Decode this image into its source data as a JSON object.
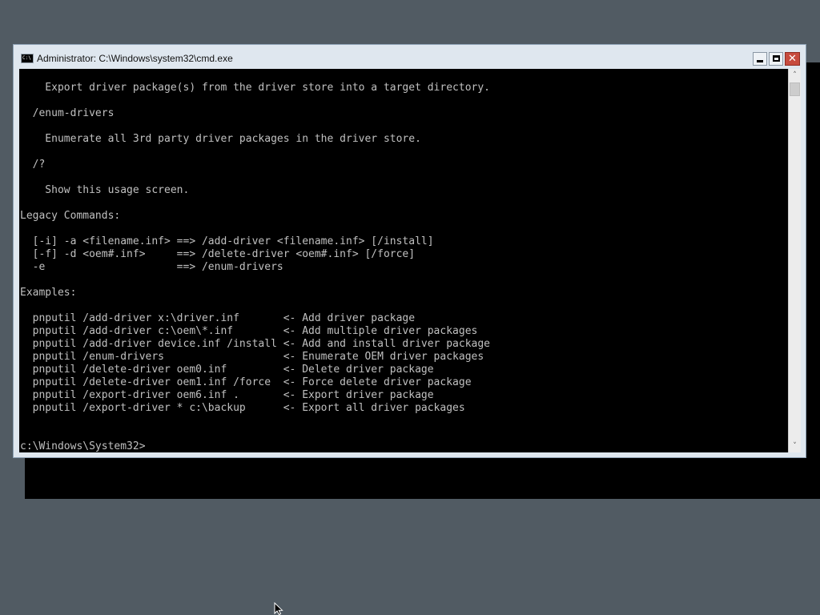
{
  "window": {
    "title": "Administrator: C:\\Windows\\system32\\cmd.exe",
    "icon_text": "C:\\",
    "icon": "cmd-icon",
    "controls": {
      "minimize": "minimize-icon",
      "maximize": "maximize-icon",
      "close_glyph": "✕"
    }
  },
  "console": {
    "lines": [
      "    Export driver package(s) from the driver store into a target directory.",
      "",
      "  /enum-drivers",
      "",
      "    Enumerate all 3rd party driver packages in the driver store.",
      "",
      "  /?",
      "",
      "    Show this usage screen.",
      "",
      "Legacy Commands:",
      "",
      "  [-i] -a <filename.inf> ==> /add-driver <filename.inf> [/install]",
      "  [-f] -d <oem#.inf>     ==> /delete-driver <oem#.inf> [/force]",
      "  -e                     ==> /enum-drivers",
      "",
      "Examples:",
      "",
      "  pnputil /add-driver x:\\driver.inf       <- Add driver package",
      "  pnputil /add-driver c:\\oem\\*.inf        <- Add multiple driver packages",
      "  pnputil /add-driver device.inf /install <- Add and install driver package",
      "  pnputil /enum-drivers                   <- Enumerate OEM driver packages",
      "  pnputil /delete-driver oem0.inf         <- Delete driver package",
      "  pnputil /delete-driver oem1.inf /force  <- Force delete driver package",
      "  pnputil /export-driver oem6.inf .       <- Export driver package",
      "  pnputil /export-driver * c:\\backup      <- Export all driver packages",
      "",
      "",
      "c:\\Windows\\System32>"
    ]
  },
  "scrollbar": {
    "up_arrow": "˄",
    "down_arrow": "˅"
  },
  "colors": {
    "desktop": "#515b63",
    "console_bg": "#000000",
    "console_fg": "#c0c0c0",
    "titlebar": "#dfe7ef",
    "close_button": "#c74b3e"
  }
}
